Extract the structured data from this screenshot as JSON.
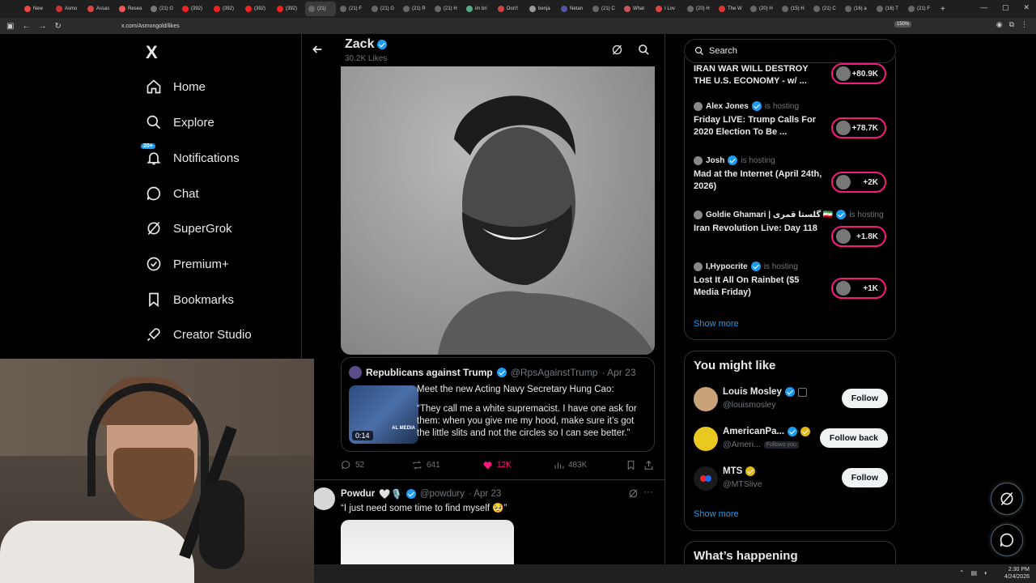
{
  "browser": {
    "tabs": [
      "New",
      "Asmo",
      "Assas",
      "Resea",
      "(21) G",
      "(392)",
      "(392)",
      "(392)",
      "(392)",
      "(21)",
      "(21) F",
      "(21) G",
      "(21) R",
      "(21) H",
      "im bri",
      "Don't",
      "benja",
      "Netan",
      "(21) C",
      "What",
      "I Lov",
      "(20) H",
      "The W",
      "(20) H",
      "(15) H",
      "(21) C",
      "(16) a",
      "(16) T",
      "(21) F"
    ],
    "active_tab_index": 9,
    "url": "x.com/Asmongold/likes",
    "zoom": "150%",
    "new_tab": "+"
  },
  "nav": {
    "logo": "X",
    "items": [
      {
        "label": "Home",
        "icon": "home-icon"
      },
      {
        "label": "Explore",
        "icon": "search-icon"
      },
      {
        "label": "Notifications",
        "icon": "bell-icon",
        "badge": "20+"
      },
      {
        "label": "Chat",
        "icon": "chat-icon"
      },
      {
        "label": "SuperGrok",
        "icon": "grok-icon"
      },
      {
        "label": "Premium+",
        "icon": "premium-icon"
      },
      {
        "label": "Bookmarks",
        "icon": "bookmark-icon"
      },
      {
        "label": "Creator Studio",
        "icon": "rocket-icon"
      }
    ]
  },
  "header": {
    "name": "Zack",
    "subtitle": "30.2K Likes"
  },
  "quote": {
    "name": "Republicans against Trump",
    "handle": "@RpsAgainstTrump",
    "date": "· Apr 23",
    "duration": "0:14",
    "thumb_caption": "AL MEDIA",
    "text1": "Meet the new Acting Navy Secretary Hung Cao:",
    "text2": "“They call me a white supremacist. I have one ask for them: when you give me my hood, make sure it’s got the little slits and not the circles so I can see better.”"
  },
  "actions": {
    "replies": "52",
    "reposts": "641",
    "likes": "12K",
    "views": "483K"
  },
  "tweet2": {
    "name": "Powdur",
    "emojis": "🤍🎙️",
    "handle": "@powdury",
    "date": "· Apr 23",
    "text": "“I just need some time to find myself 🥺”",
    "more": "···"
  },
  "right": {
    "search_placeholder": "Search",
    "live": [
      {
        "host": "",
        "title": "IRAN WAR WILL DESTROY THE U.S. ECONOMY - w/ ...",
        "count": "+80.9K"
      },
      {
        "host": "Alex Jones",
        "hosting": "is hosting",
        "title": "Friday LIVE: Trump Calls For 2020 Election To Be ...",
        "count": "+78.7K"
      },
      {
        "host": "Josh",
        "hosting": "is hosting",
        "title": "Mad at the Internet (April 24th, 2026)",
        "count": "+2K"
      },
      {
        "host": "Goldie Ghamari | گلستا قمری 🇮🇷",
        "hosting": "is hosting",
        "title": "Iran Revolution Live: Day 118",
        "count": "+1.8K"
      },
      {
        "host": "I,Hypocrite",
        "hosting": "is hosting",
        "title": "Lost It All On Rainbet ($5 Media Friday)",
        "count": "+1K"
      }
    ],
    "show_more": "Show more",
    "wtf_title": "You might like",
    "wtf": [
      {
        "name": "Louis Mosley",
        "handle": "@louismosley",
        "button": "Follow",
        "color": "#c9a27a"
      },
      {
        "name": "AmericanPa...",
        "handle": "@Ameri...",
        "follows_you": "Follows you",
        "button": "Follow back",
        "color": "#e9c81f"
      },
      {
        "name": "MTS",
        "handle": "@MTSlive",
        "button": "Follow",
        "color": "#1a1a1a"
      }
    ],
    "wtf_show_more": "Show more",
    "whats_happening": "What’s happening"
  },
  "taskbar": {
    "time": "2:30 PM",
    "date": "4/24/2026"
  },
  "colors": {
    "accent": "#1d9bf0",
    "like": "#f91880",
    "background": "#000000",
    "border": "#2f3336",
    "muted": "#71767b"
  }
}
